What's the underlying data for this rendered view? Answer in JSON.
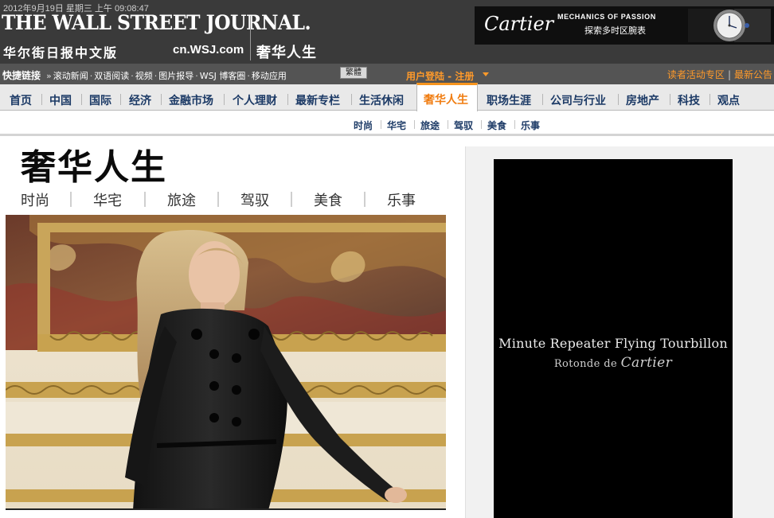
{
  "header": {
    "datetime": "2012年9月19日 星期三 上午 09:08:47",
    "masthead": "THE WALL STREET JOURNAL.",
    "cn_name": "华尔街日报中文版",
    "site_url": "cn.WSJ.com",
    "section_name": "奢华人生",
    "ad": {
      "brand": "Cartier",
      "tagline": "MECHANICS OF PASSION",
      "cta": "探索多时区腕表"
    }
  },
  "quickbar": {
    "label": "快捷链接",
    "links": [
      "滚动新闻",
      "双语阅读",
      "视频",
      "图片报导",
      "WSJ 博客圈",
      "移动应用"
    ],
    "traditional_button": "繁體",
    "login": "用户登陆 - 注册",
    "right_links": [
      "读者活动专区",
      "最新公告"
    ]
  },
  "nav": {
    "items": [
      "首页",
      "中国",
      "国际",
      "经济",
      "金融市场",
      "个人理财",
      "最新专栏",
      "生活休闲",
      "奢华人生",
      "职场生涯",
      "公司与行业",
      "房地产",
      "科技",
      "观点"
    ],
    "active_index": 8
  },
  "subnav": {
    "items": [
      "时尚",
      "华宅",
      "旅途",
      "驾驭",
      "美食",
      "乐事"
    ]
  },
  "section": {
    "title": "奢华人生",
    "categories": [
      "时尚",
      "华宅",
      "旅途",
      "驾驭",
      "美食",
      "乐事"
    ]
  },
  "side_ad": {
    "title": "Minute Repeater Flying Tourbillon",
    "subtitle_prefix": "Rotonde de",
    "brand": "Cartier"
  },
  "icons": [
    "caret-down-icon",
    "watch-icon"
  ],
  "colors": {
    "header_bg": "#3a3a3a",
    "quickbar_bg": "#545454",
    "nav_text": "#1c3a66",
    "accent": "#f7941d",
    "login": "#ff9a2a"
  }
}
